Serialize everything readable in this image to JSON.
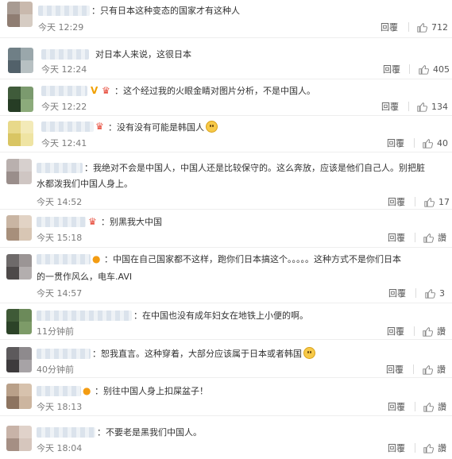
{
  "comments": [
    {
      "text": "：只有日本这种变态的国家才有这种人",
      "text2": "",
      "time": "今天 12:29",
      "reply": "回覆",
      "likes": "712",
      "badges": []
    },
    {
      "text": "对日本人来说，这很日本",
      "text2": "",
      "time": "今天 12:24",
      "reply": "回覆",
      "likes": "405",
      "badges": []
    },
    {
      "text": "：这个经过我的火眼金睛对图片分析，不是中国人。",
      "text2": "",
      "time": "今天 12:22",
      "reply": "回覆",
      "likes": "134",
      "badges": [
        "v-badge",
        "crown-badge"
      ]
    },
    {
      "text": "：没有没有可能是韩国人",
      "text2": "",
      "time": "今天 12:41",
      "reply": "回覆",
      "likes": "40",
      "badges": [
        "crown-badge"
      ]
    },
    {
      "text": "：我绝对不会是中国人，中国人还是比较保守的。这么奔放，应该是他们自己人。别把脏",
      "text2": "水都泼我们中国人身上。",
      "time": "今天 14:52",
      "reply": "回覆",
      "likes": "17",
      "badges": []
    },
    {
      "text": "：别黑我大中国",
      "text2": "",
      "time": "今天 15:18",
      "reply": "回覆",
      "likes": "讚",
      "badges": [
        "crown-badge"
      ]
    },
    {
      "text": "：中国在自己国家都不这样，跑你们日本搞这个。。。。。这种方式不是你们日本",
      "text2": "的一贯作风么，电车.AVI",
      "time": "今天 14:57",
      "reply": "回覆",
      "likes": "3",
      "badges": [
        "balloon-badge"
      ]
    },
    {
      "text": "：在中国也没有成年妇女在地铁上小便的啊。",
      "text2": "",
      "time": "11分钟前",
      "reply": "回覆",
      "likes": "讚",
      "badges": []
    },
    {
      "text": "：恕我直言。这种穿着，大部分应该属于日本或者韩国",
      "text2": "",
      "time": "40分钟前",
      "reply": "回覆",
      "likes": "讚",
      "badges": []
    },
    {
      "text": "：别往中国人身上扣屎盆子！",
      "text2": "",
      "time": "今天 18:13",
      "reply": "回覆",
      "likes": "讚",
      "badges": [
        "balloon-badge"
      ]
    },
    {
      "text": "：不要老是黑我们中国人。",
      "text2": "",
      "time": "今天 18:04",
      "reply": "回覆",
      "likes": "讚",
      "badges": []
    }
  ],
  "colors": {
    "meta": "#7b7b7b",
    "text": "#333333",
    "divider": "#eeeeee"
  }
}
